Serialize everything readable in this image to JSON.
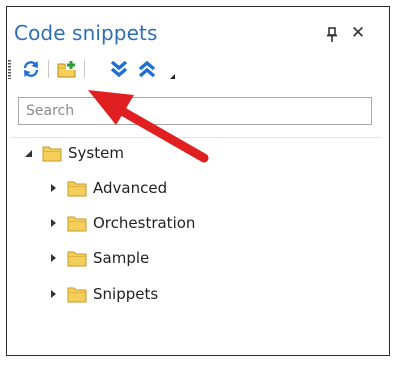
{
  "panel": {
    "title": "Code snippets",
    "close_glyph": "✕"
  },
  "icons": {
    "pin": "pin-icon",
    "close": "close-icon",
    "refresh": "refresh-icon",
    "add_folder": "add-folder-icon",
    "expand_all": "expand-all-icon",
    "collapse_all": "collapse-all-icon",
    "overflow": "toolbar-overflow-icon",
    "folder": "folder-icon",
    "annotation": "red-arrow-annotation"
  },
  "search": {
    "placeholder": "Search",
    "value": ""
  },
  "tree": {
    "root": {
      "label": "System",
      "expanded": true
    },
    "children": [
      {
        "label": "Advanced",
        "expanded": false
      },
      {
        "label": "Orchestration",
        "expanded": false
      },
      {
        "label": "Sample",
        "expanded": false
      },
      {
        "label": "Snippets",
        "expanded": false
      }
    ]
  },
  "colors": {
    "title": "#2e6fb6",
    "icon_blue": "#1f6fd1",
    "folder_yellow": "#f4cf5a",
    "add_green": "#2e9e3a",
    "annotation_red": "#e02020"
  }
}
